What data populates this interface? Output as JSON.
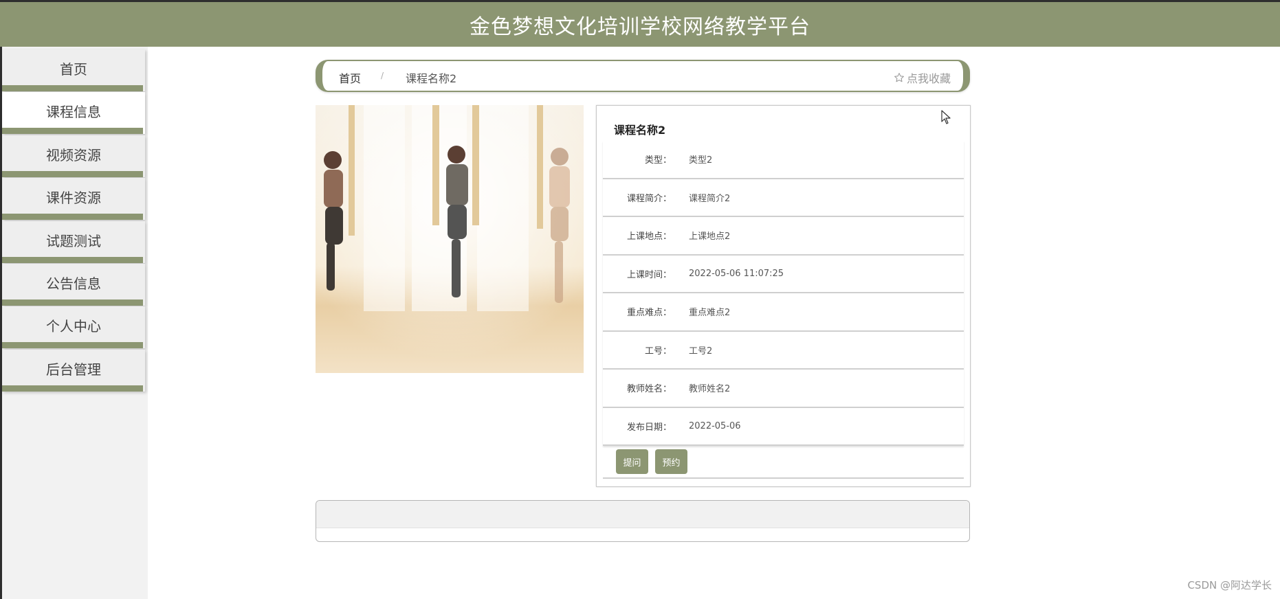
{
  "header": {
    "title": "金色梦想文化培训学校网络教学平台"
  },
  "sidebar": {
    "items": [
      {
        "label": "首页"
      },
      {
        "label": "课程信息"
      },
      {
        "label": "视频资源"
      },
      {
        "label": "课件资源"
      },
      {
        "label": "试题测试"
      },
      {
        "label": "公告信息"
      },
      {
        "label": "个人中心"
      },
      {
        "label": "后台管理"
      }
    ],
    "active_index": 1
  },
  "breadcrumb": {
    "home": "首页",
    "separator": "/",
    "current": "课程名称2",
    "collect": "点我收藏",
    "collect_icon": "star-outline-icon"
  },
  "detail": {
    "title": "课程名称2",
    "rows": [
      {
        "label": "类型：",
        "value": "类型2"
      },
      {
        "label": "课程简介：",
        "value": "课程简介2"
      },
      {
        "label": "上课地点：",
        "value": "上课地点2"
      },
      {
        "label": "上课时间：",
        "value": "2022-05-06 11:07:25"
      },
      {
        "label": "重点难点：",
        "value": "重点难点2"
      },
      {
        "label": "工号：",
        "value": "工号2"
      },
      {
        "label": "教师姓名：",
        "value": "教师姓名2"
      },
      {
        "label": "发布日期：",
        "value": "2022-05-06"
      }
    ],
    "buttons": {
      "ask": "提问",
      "reserve": "预约"
    }
  },
  "watermark": "CSDN @阿达学长",
  "colors": {
    "accent": "#8c9672",
    "header_text": "#ffffff",
    "sidebar_bg": "#f2f2f2"
  }
}
